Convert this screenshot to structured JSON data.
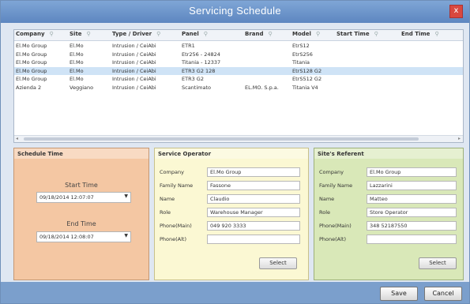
{
  "window": {
    "title": "Servicing Schedule",
    "close_label": "x"
  },
  "grid": {
    "columns": [
      "Company",
      "Site",
      "Type / Driver",
      "Panel",
      "Brand",
      "Model",
      "Start Time",
      "End Time"
    ],
    "rows": [
      [
        "El.Mo Group",
        "El.Mo",
        "Intrusion / CeiAbi",
        "ETR1",
        "",
        "EtrS12",
        "",
        ""
      ],
      [
        "El.Mo Group",
        "El.Mo",
        "Intrusion / CeiAbi",
        "Etr256 - 24824",
        "",
        "EtrS256",
        "",
        ""
      ],
      [
        "El.Mo Group",
        "El.Mo",
        "Intrusion / CeiAbi",
        "Titania - 12337",
        "",
        "Titania",
        "",
        ""
      ],
      [
        "El.Mo Group",
        "El.Mo",
        "Intrusion / CeiAbi",
        "ETR3 G2 128",
        "",
        "EtrS128 G2",
        "",
        ""
      ],
      [
        "El.Mo Group",
        "El.Mo",
        "Intrusion / CeiAbi",
        "ETR3 G2",
        "",
        "EtrS512 G2",
        "",
        ""
      ],
      [
        "Azienda 2",
        "Veggiano",
        "Intrusion / CeiAbi",
        "Scantimato",
        "EL.MO. S.p.a.",
        "Titania V4",
        "",
        ""
      ]
    ],
    "selected_row": 3
  },
  "schedule": {
    "title": "Schedule Time",
    "start_label": "Start Time",
    "start_value": "09/18/2014 12:07:07",
    "end_label": "End Time",
    "end_value": "09/18/2014 12:08:07"
  },
  "operator": {
    "title": "Service Operator",
    "fields": [
      {
        "label": "Company",
        "value": "El.Mo Group"
      },
      {
        "label": "Family Name",
        "value": "Fassone"
      },
      {
        "label": "Name",
        "value": "Claudio"
      },
      {
        "label": "Role",
        "value": "Warehouse Manager"
      },
      {
        "label": "Phone(Main)",
        "value": "049 920 3333"
      },
      {
        "label": "Phone(Alt)",
        "value": ""
      }
    ],
    "select_label": "Select"
  },
  "referent": {
    "title": "Site's Referent",
    "fields": [
      {
        "label": "Company",
        "value": "El.Mo Group"
      },
      {
        "label": "Family Name",
        "value": "Lazzarini"
      },
      {
        "label": "Name",
        "value": "Matteo"
      },
      {
        "label": "Role",
        "value": "Store Operator"
      },
      {
        "label": "Phone(Main)",
        "value": "348 52187550"
      },
      {
        "label": "Phone(Alt)",
        "value": ""
      }
    ],
    "select_label": "Select"
  },
  "footer": {
    "save_label": "Save",
    "cancel_label": "Cancel"
  },
  "colors": {
    "title_bar": "#5d86c0",
    "schedule_bg": "#f4c7a3",
    "operator_bg": "#fbf8d3",
    "referent_bg": "#d9e8b8",
    "selected_row": "#cfe3f6"
  }
}
